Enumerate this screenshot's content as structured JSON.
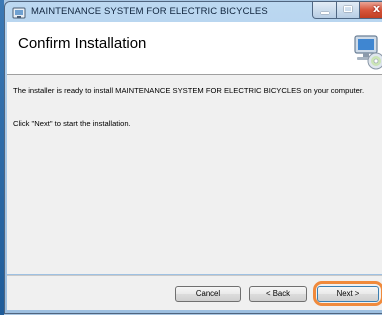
{
  "window": {
    "title": "MAINTENANCE SYSTEM FOR ELECTRIC BICYCLES",
    "close_glyph": "x"
  },
  "header": {
    "title": "Confirm Installation",
    "graphic_icon": "setup-computer-cd-icon"
  },
  "content": {
    "line1": "The installer is ready to install MAINTENANCE SYSTEM FOR ELECTRIC BICYCLES on your computer.",
    "line2": "Click \"Next\" to start the installation."
  },
  "footer": {
    "cancel_label": "Cancel",
    "back_label": "< Back",
    "next_label": "Next >"
  },
  "colors": {
    "highlight": "#f08a3c",
    "close_button": "#d8563c",
    "title_bar": "#a8c9e8"
  }
}
